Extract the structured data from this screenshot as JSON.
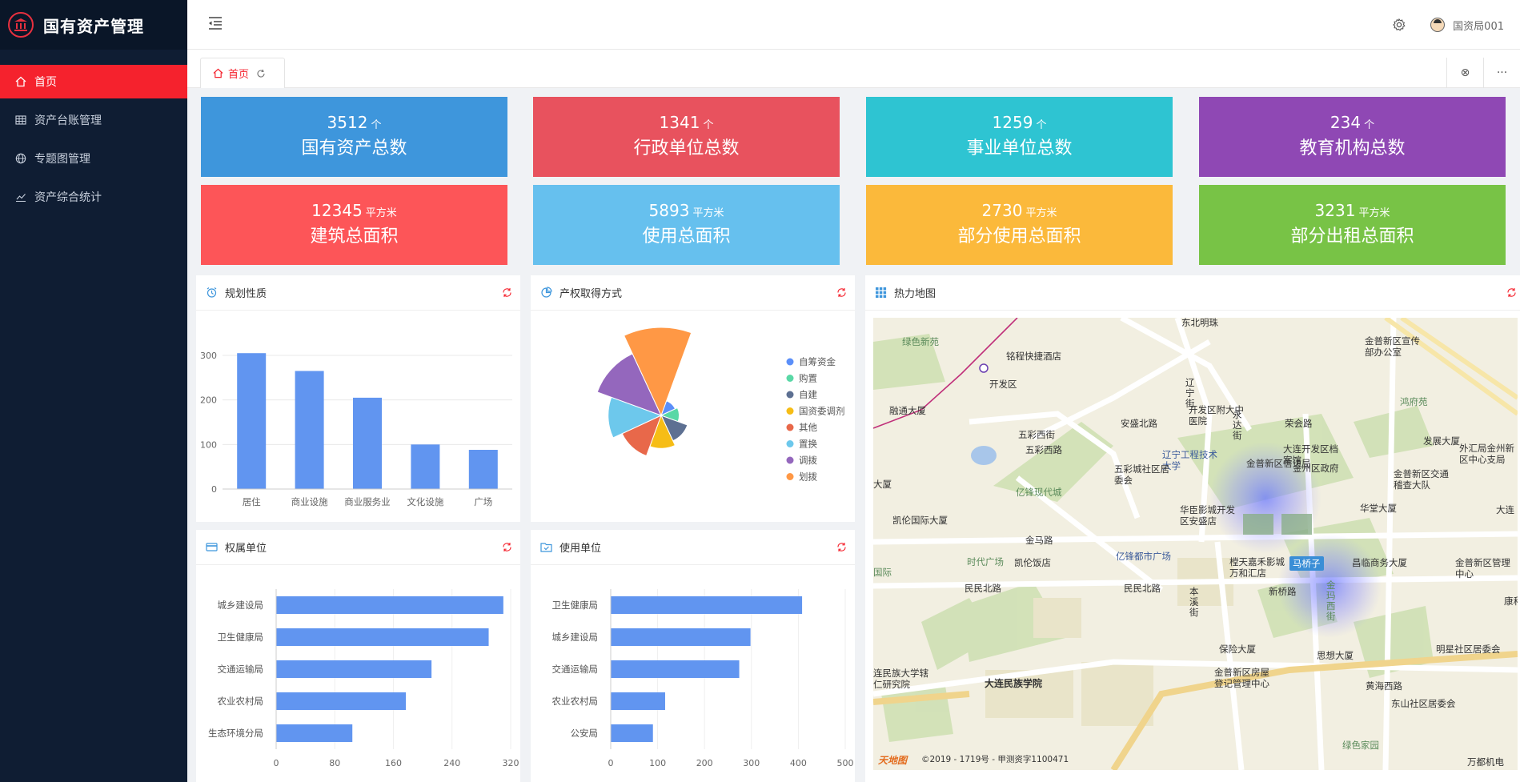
{
  "app": {
    "title": "国有资产管理"
  },
  "sidebar": {
    "items": [
      {
        "label": "首页",
        "icon": "home-icon",
        "active": true
      },
      {
        "label": "资产台账管理",
        "icon": "table-icon",
        "active": false
      },
      {
        "label": "专题图管理",
        "icon": "globe-icon",
        "active": false
      },
      {
        "label": "资产综合统计",
        "icon": "line-chart-icon",
        "active": false
      }
    ]
  },
  "header": {
    "username": "国资局001"
  },
  "tabs": [
    {
      "label": "首页"
    }
  ],
  "tabbar": {
    "close_all": "⊗",
    "more": "···"
  },
  "stats": [
    {
      "value": "3512",
      "unit": "个",
      "label": "国有资产总数",
      "color": "#3e96dc"
    },
    {
      "value": "1341",
      "unit": "个",
      "label": "行政单位总数",
      "color": "#e8525e"
    },
    {
      "value": "1259",
      "unit": "个",
      "label": "事业单位总数",
      "color": "#2ec4d2"
    },
    {
      "value": "234",
      "unit": "个",
      "label": "教育机构总数",
      "color": "#8f48b4"
    },
    {
      "value": "12345",
      "unit": "平方米",
      "label": "建筑总面积",
      "color": "#fd5558"
    },
    {
      "value": "5893",
      "unit": "平方米",
      "label": "使用总面积",
      "color": "#66c0ee"
    },
    {
      "value": "2730",
      "unit": "平方米",
      "label": "部分使用总面积",
      "color": "#fbb93b"
    },
    {
      "value": "3231",
      "unit": "平方米",
      "label": "部分出租总面积",
      "color": "#78c346"
    }
  ],
  "panels": {
    "planning": {
      "title": "规划性质"
    },
    "property": {
      "title": "产权取得方式"
    },
    "heatmap": {
      "title": "热力地图"
    },
    "owner": {
      "title": "权属单位"
    },
    "user": {
      "title": "使用单位"
    }
  },
  "chart_data": [
    {
      "type": "bar",
      "title": "规划性质",
      "categories": [
        "居住",
        "商业设施",
        "商业服务业",
        "文化设施",
        "广场"
      ],
      "values": [
        305,
        265,
        205,
        100,
        88
      ],
      "ylim": [
        0,
        300
      ],
      "yticks": [
        0,
        100,
        200,
        300
      ],
      "color": "#6195f0"
    },
    {
      "type": "pie",
      "title": "产权取得方式",
      "legend_position": "right",
      "slices": [
        {
          "name": "自筹资金",
          "value": 1.5,
          "color": "#5b8ff9"
        },
        {
          "name": "购置",
          "value": 2,
          "color": "#5ad8a6"
        },
        {
          "name": "自建",
          "value": 4,
          "color": "#5d7092"
        },
        {
          "name": "国资委调剂",
          "value": 5,
          "color": "#f6bd16"
        },
        {
          "name": "其他",
          "value": 7,
          "color": "#e8684a"
        },
        {
          "name": "置换",
          "value": 9,
          "color": "#6dc8ec"
        },
        {
          "name": "调拨",
          "value": 12,
          "color": "#9467bd"
        },
        {
          "name": "划拨",
          "value": 16,
          "color": "#ff9845"
        }
      ]
    },
    {
      "type": "bar",
      "orientation": "horizontal",
      "title": "权属单位",
      "categories": [
        "城乡建设局",
        "卫生健康局",
        "交通运输局",
        "农业农村局",
        "生态环境分局"
      ],
      "values": [
        310,
        290,
        212,
        177,
        104
      ],
      "xlim": [
        0,
        320
      ],
      "xticks": [
        0,
        80,
        160,
        240,
        320
      ],
      "color": "#6195f0"
    },
    {
      "type": "bar",
      "orientation": "horizontal",
      "title": "使用单位",
      "categories": [
        "卫生健康局",
        "城乡建设局",
        "交通运输局",
        "农业农村局",
        "公安局"
      ],
      "values": [
        408,
        298,
        274,
        116,
        90
      ],
      "xlim": [
        0,
        500
      ],
      "xticks": [
        0,
        100,
        200,
        300,
        400,
        500
      ],
      "color": "#6195f0"
    }
  ],
  "map": {
    "copyright": "©2019 - 1719号 - 甲测资字1100471",
    "logo": "天地图",
    "labels": [
      {
        "t": "东北明珠",
        "c": ""
      },
      {
        "t": "绿色新苑",
        "c": "g"
      },
      {
        "t": "铭程快捷酒店",
        "c": ""
      },
      {
        "t": "金普新区宣传部办公室",
        "c": ""
      },
      {
        "t": "开发区",
        "c": ""
      },
      {
        "t": "辽宁街",
        "c": ""
      },
      {
        "t": "鸿府苑",
        "c": "g"
      },
      {
        "t": "融通大厦",
        "c": ""
      },
      {
        "t": "开发区附大中医院",
        "c": ""
      },
      {
        "t": "安盛北路",
        "c": ""
      },
      {
        "t": "荣会路",
        "c": ""
      },
      {
        "t": "永达街",
        "c": ""
      },
      {
        "t": "大连开发区档案馆",
        "c": ""
      },
      {
        "t": "发展大厦",
        "c": ""
      },
      {
        "t": "外汇局金州新区中心支局",
        "c": ""
      },
      {
        "t": "五彩西街",
        "c": ""
      },
      {
        "t": "辽宁工程技术大学",
        "c": "b"
      },
      {
        "t": "金普新区信访局",
        "c": ""
      },
      {
        "t": "金州区政府",
        "c": ""
      },
      {
        "t": "金普新区交通稽查大队",
        "c": ""
      },
      {
        "t": "五彩城社区居委会",
        "c": ""
      },
      {
        "t": "亿锋现代城",
        "c": "g"
      },
      {
        "t": "华臣影城开发区安盛店",
        "c": ""
      },
      {
        "t": "华堂大厦",
        "c": ""
      },
      {
        "t": "凯伦国际大厦",
        "c": ""
      },
      {
        "t": "金马路",
        "c": ""
      },
      {
        "t": "时代广场",
        "c": "g"
      },
      {
        "t": "凯伦饭店",
        "c": ""
      },
      {
        "t": "亿锋都市广场",
        "c": "b"
      },
      {
        "t": "樘天嘉禾影城万和汇店",
        "c": ""
      },
      {
        "t": "马桥子",
        "c": "badge"
      },
      {
        "t": "昌临商务大厦",
        "c": ""
      },
      {
        "t": "金普新区管理中心",
        "c": ""
      },
      {
        "t": "国际",
        "c": "g"
      },
      {
        "t": "民民北路",
        "c": ""
      },
      {
        "t": "民民北路",
        "c": ""
      },
      {
        "t": "新桥路",
        "c": ""
      },
      {
        "t": "本溪街",
        "c": ""
      },
      {
        "t": "金玛西街",
        "c": "g"
      },
      {
        "t": "康和",
        "c": ""
      },
      {
        "t": "保险大厦",
        "c": ""
      },
      {
        "t": "思想大厦",
        "c": ""
      },
      {
        "t": "明星社区居委会",
        "c": ""
      },
      {
        "t": "连民族大学辖仁研究院",
        "c": ""
      },
      {
        "t": "大连民族学院",
        "c": "bold"
      },
      {
        "t": "金普新区房屋登记管理中心",
        "c": ""
      },
      {
        "t": "黄海西路",
        "c": ""
      },
      {
        "t": "东山社区居委会",
        "c": ""
      },
      {
        "t": "绿色家园",
        "c": "g"
      },
      {
        "t": "万都机电",
        "c": ""
      },
      {
        "t": "大连",
        "c": ""
      },
      {
        "t": "大厦",
        "c": ""
      },
      {
        "t": "五彩西路",
        "c": ""
      }
    ]
  }
}
